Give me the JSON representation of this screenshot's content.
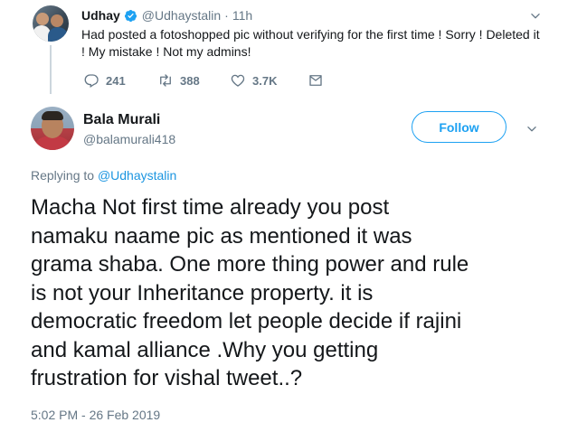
{
  "parent_tweet": {
    "name": "Udhay",
    "handle": "@Udhaystalin",
    "separator": "·",
    "time": "11h",
    "text": "Had posted a fotoshopped pic without verifying for the first time ! Sorry ! Deleted it ! My mistake ! Not my admins!",
    "replies": "241",
    "retweets": "388",
    "likes": "3.7K",
    "icons": [
      "reply-icon",
      "retweet-icon",
      "like-icon",
      "direct-message-icon",
      "verified-badge-icon",
      "chevron-down-icon"
    ]
  },
  "main_tweet": {
    "name": "Bala Murali",
    "handle": "@balamurali418",
    "follow_label": "Follow",
    "replying_prefix": "Replying to ",
    "replying_handle": "@Udhaystalin",
    "text_lines": [
      "Macha Not first time already you post",
      "namaku naame pic as mentioned it was",
      "grama shaba. One more thing power and rule",
      "is not your Inheritance property. it is",
      "democratic freedom let people decide if rajini",
      "and kamal alliance .Why you getting",
      "frustration for vishal tweet..?"
    ],
    "timestamp": "5:02 PM - 26 Feb 2019"
  },
  "colors": {
    "accent": "#1da1f2",
    "link": "#1b95e0",
    "secondary_text": "#657786",
    "primary_text": "#14171a",
    "thread_line": "#ccd6dd"
  }
}
